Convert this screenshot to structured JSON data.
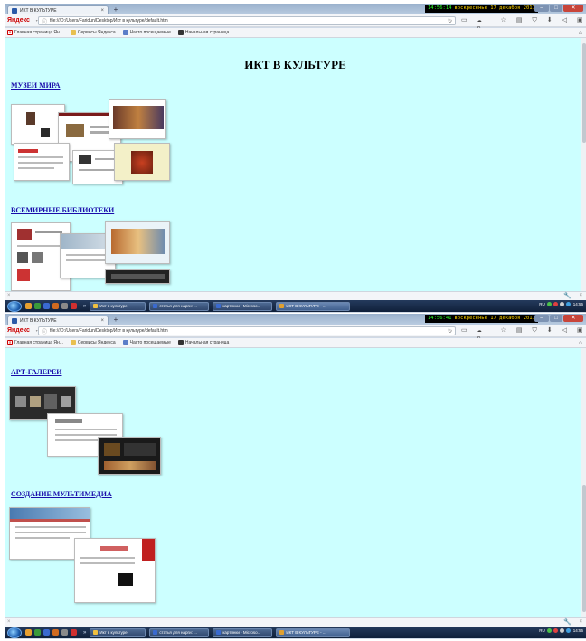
{
  "screens": [
    {
      "browser": {
        "tab_title": "ИКТ В КУЛЬТУРЕ",
        "tab_close": "×",
        "new_tab": "+",
        "clock_time": "14:56:14",
        "clock_date": "воскресенье 17 декабря 2017",
        "brand": "Яндекс",
        "url": "file:///D:/Users/Faridun/Desktop/Икт в культуре/default.htm",
        "weather": "9",
        "bookmarks": [
          "Главная страница Ян...",
          "Сервисы Яндекса",
          "Часто посещаемые",
          "Начальная страница"
        ]
      },
      "page": {
        "title": "ИКТ В КУЛЬТУРЕ",
        "sections": [
          "МУЗЕИ МИРА",
          "ВСЕМИРНЫЕ БИБЛИОТЕКИ"
        ]
      },
      "taskbar": {
        "items": [
          "Икт в культуре",
          "статья для нарги: ...",
          "картинки - Microso...",
          "ИКТ В КУЛЬТУРЕ - ..."
        ],
        "tray_lang": "RU",
        "tray_time": "14:56"
      }
    },
    {
      "browser": {
        "tab_title": "ИКТ В КУЛЬТУРЕ",
        "tab_close": "×",
        "new_tab": "+",
        "clock_time": "14:56:41",
        "clock_date": "воскресенье 17 декабря 2017",
        "brand": "Яндекс",
        "url": "file:///D:/Users/Faridun/Desktop/Икт в культуре/default.htm",
        "weather": "9",
        "bookmarks": [
          "Главная страница Ян...",
          "Сервисы Яндекса",
          "Часто посещаемые",
          "Начальная страница"
        ]
      },
      "page": {
        "sections": [
          "АРТ-ГАЛЕРЕИ",
          "СОЗДАНИЕ МУЛЬТИМЕДИА"
        ]
      },
      "taskbar": {
        "items": [
          "Икт в культуре",
          "статья для нарги: ...",
          "картинки - Microso...",
          "ИКТ В КУЛЬТУРЕ - ..."
        ],
        "tray_lang": "RU",
        "tray_time": "14:56"
      }
    }
  ],
  "icons": [
    "back-arrow-icon",
    "info-icon",
    "reload-icon",
    "star-icon",
    "clipboard-icon",
    "shield-icon",
    "download-icon",
    "share-icon",
    "cart-icon",
    "menu-icon",
    "home-icon",
    "wrench-icon",
    "close-icon"
  ],
  "colors": {
    "page_background": "#ccffff",
    "link": "#1a0dab",
    "clock_time": "#28ff28",
    "clock_date": "#ffd400"
  }
}
